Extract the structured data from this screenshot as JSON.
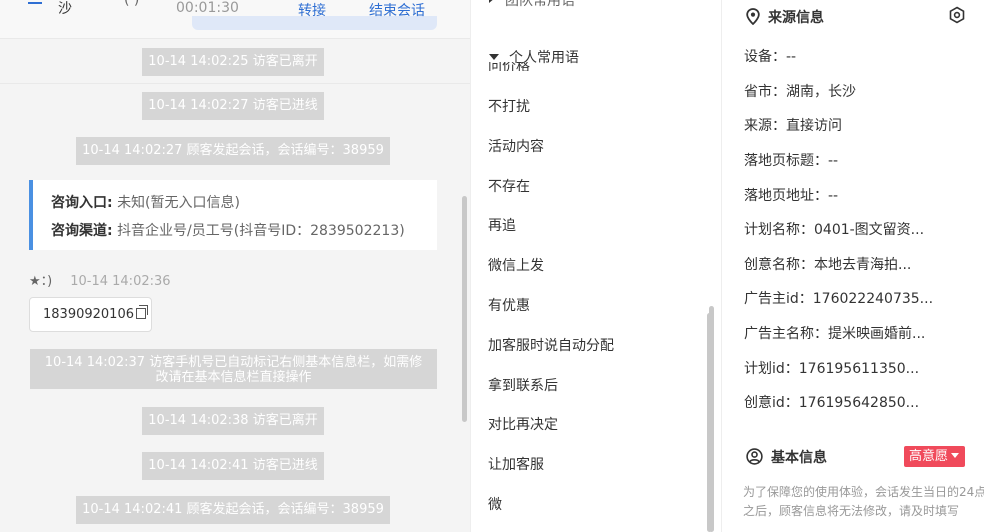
{
  "chat": {
    "top": {
      "frag_left": "沙",
      "frag_mid": "( )",
      "duration": "00:01:30",
      "transfer_label": "转接",
      "end_label": "结束会话"
    },
    "system": [
      "10-14 14:02:25 访客已离开",
      "10-14 14:02:27 访客已进线",
      "10-14 14:02:27 顾客发起会话，会话编号：38959",
      "10-14 14:02:37 访客手机号已自动标记右侧基本信息栏，如需修改请在基本信息栏直接操作",
      "10-14 14:02:38 访客已离开",
      "10-14 14:02:41 访客已进线",
      "10-14 14:02:41 顾客发起会话，会话编号：38959"
    ],
    "entry": {
      "k1": "咨询入口:",
      "v1": "未知(暂无入口信息)",
      "k2": "咨询渠道:",
      "v2": "抖音企业号/员工号(抖音号ID：2839502213)"
    },
    "visitor": {
      "name": "★：)",
      "time": "10-14 14:02:36",
      "phone": "18390920106"
    }
  },
  "quick": {
    "team_group": "团队常用语",
    "personal_group": "个人常用语",
    "cut_item": "问价格",
    "phrases": [
      "不打扰",
      "活动内容",
      "不存在",
      "再追",
      "微信上发",
      "有优惠",
      "加客服时说自动分配",
      "拿到联系后",
      "对比再决定",
      "让加客服",
      "微"
    ]
  },
  "info": {
    "source_title": "来源信息",
    "fields": [
      "设备：--",
      "省市：湖南，长沙",
      "来源：直接访问",
      "落地页标题：--",
      "落地页地址：--",
      "计划名称：0401-图文留资...",
      "创意名称：本地去青海拍...",
      "广告主id：176022240735...",
      "广告主名称：提米映画婚前...",
      "计划id：176195611350...",
      "创意id：176195642850..."
    ],
    "basic_title": "基本信息",
    "intent_badge": "高意愿",
    "note": "为了保障您的使用体验，会话发生当日的24点之后，顾客信息将无法修改，请及时填写"
  }
}
